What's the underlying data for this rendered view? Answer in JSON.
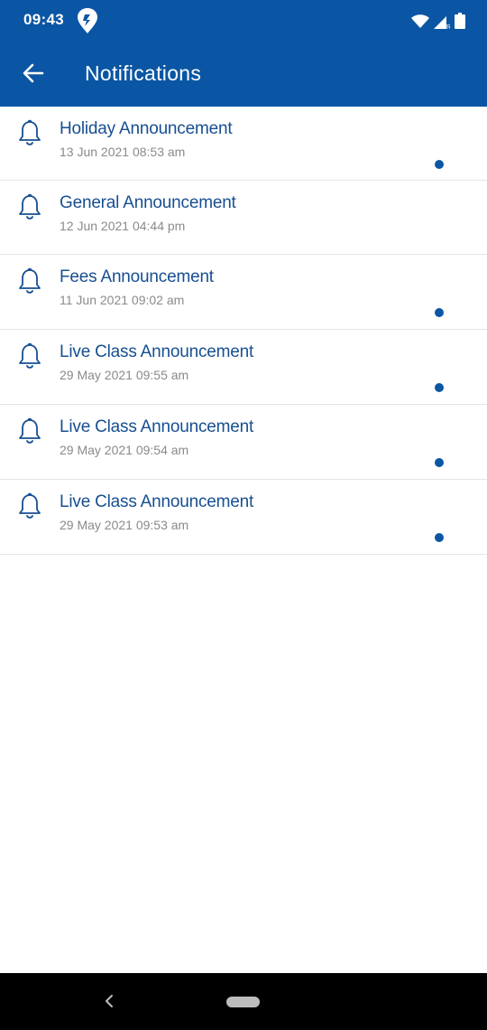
{
  "status_bar": {
    "time": "09:43",
    "icons": [
      "app-logo-icon",
      "wifi-icon",
      "signal-icon",
      "battery-icon"
    ],
    "signal_label": "R"
  },
  "app_bar": {
    "title": "Notifications",
    "back_icon": "arrow-left-icon",
    "background": "#0b56a4"
  },
  "notifications": [
    {
      "title": "Holiday Announcement",
      "time": "13 Jun 2021 08:53 am",
      "unread": true
    },
    {
      "title": "General Announcement",
      "time": "12 Jun 2021 04:44 pm",
      "unread": false
    },
    {
      "title": "Fees Announcement",
      "time": "11 Jun 2021 09:02 am",
      "unread": true
    },
    {
      "title": "Live Class Announcement",
      "time": "29 May 2021 09:55 am",
      "unread": true
    },
    {
      "title": "Live Class Announcement",
      "time": "29 May 2021 09:54 am",
      "unread": true
    },
    {
      "title": "Live Class Announcement",
      "time": "29 May 2021 09:53 am",
      "unread": true
    }
  ],
  "colors": {
    "accent": "#0b56a4",
    "title_text": "#174f91",
    "time_text": "#8a8a8a"
  },
  "nav_bar": {
    "icons": [
      "nav-back-icon",
      "home-pill-icon"
    ]
  }
}
